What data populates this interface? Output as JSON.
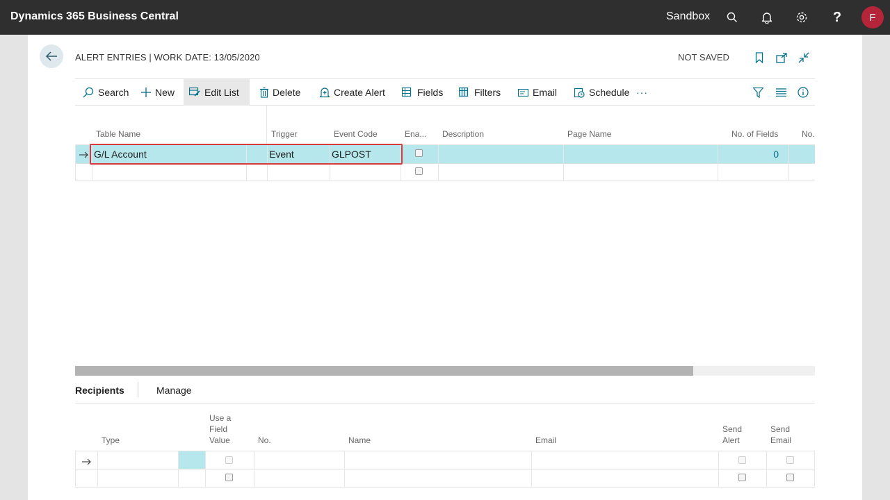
{
  "topbar": {
    "brand": "Dynamics 365 Business Central",
    "company": "Sandbox",
    "avatar_initial": "F",
    "icons": [
      "search-icon",
      "bell-icon",
      "gear-icon",
      "help-icon"
    ]
  },
  "header": {
    "title": "ALERT ENTRIES | WORK DATE: 13/05/2020",
    "status": "NOT SAVED"
  },
  "actions": {
    "search": "Search",
    "new": "New",
    "edit_list": "Edit List",
    "delete": "Delete",
    "create_alert": "Create Alert",
    "fields": "Fields",
    "filters": "Filters",
    "email": "Email",
    "schedule": "Schedule",
    "more": "···"
  },
  "grid": {
    "columns": {
      "table_name": "Table Name",
      "trigger": "Trigger",
      "event_code": "Event Code",
      "enabled": "Ena...",
      "description": "Description",
      "page_name": "Page Name",
      "no_of_fields": "No. of Fields",
      "no": "No."
    },
    "rows": [
      {
        "table_name": "G/L Account",
        "trigger": "Event",
        "event_code": "GLPOST",
        "enabled": false,
        "description": "",
        "page_name": "",
        "no_of_fields": "0",
        "no": ""
      },
      {
        "table_name": "",
        "trigger": "",
        "event_code": "",
        "enabled": false,
        "description": "",
        "page_name": "",
        "no_of_fields": "",
        "no": ""
      }
    ]
  },
  "subpage": {
    "tabs": {
      "recipients": "Recipients",
      "manage": "Manage"
    },
    "columns": {
      "type": "Type",
      "use_field_value_1": "Use a",
      "use_field_value_2": "Field",
      "use_field_value_3": "Value",
      "no": "No.",
      "name": "Name",
      "email": "Email",
      "send_alert_1": "Send",
      "send_alert_2": "Alert",
      "send_email_1": "Send",
      "send_email_2": "Email"
    }
  },
  "colors": {
    "topbar": "#2f2f2f",
    "selected_row": "#b6e7ec",
    "accent": "#00718a",
    "highlight_box": "#d9393e",
    "avatar": "#b4253a"
  }
}
